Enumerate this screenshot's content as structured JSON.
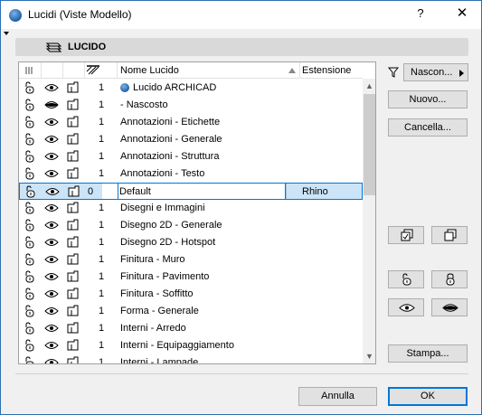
{
  "window": {
    "title": "Lucidi (Viste Modello)",
    "help_label": "?",
    "close_label": "✕"
  },
  "panel": {
    "title": "LUCIDO"
  },
  "list": {
    "columns": {
      "name": "Nome Lucido",
      "extension": "Estensione"
    },
    "rows": [
      {
        "num": "1",
        "name": "Lucido ARCHICAD",
        "ext": "",
        "eye": "open",
        "special_icon": true
      },
      {
        "num": "1",
        "name": "- Nascosto",
        "ext": "",
        "eye": "closed"
      },
      {
        "num": "1",
        "name": "Annotazioni - Etichette",
        "ext": "",
        "eye": "open"
      },
      {
        "num": "1",
        "name": "Annotazioni - Generale",
        "ext": "",
        "eye": "open"
      },
      {
        "num": "1",
        "name": "Annotazioni - Struttura",
        "ext": "",
        "eye": "open"
      },
      {
        "num": "1",
        "name": "Annotazioni - Testo",
        "ext": "",
        "eye": "open"
      },
      {
        "num": "0",
        "name": "Default",
        "ext": "Rhino",
        "eye": "open",
        "selected": true
      },
      {
        "num": "1",
        "name": "Disegni e Immagini",
        "ext": "",
        "eye": "open"
      },
      {
        "num": "1",
        "name": "Disegno 2D - Generale",
        "ext": "",
        "eye": "open"
      },
      {
        "num": "1",
        "name": "Disegno 2D - Hotspot",
        "ext": "",
        "eye": "open"
      },
      {
        "num": "1",
        "name": "Finitura - Muro",
        "ext": "",
        "eye": "open"
      },
      {
        "num": "1",
        "name": "Finitura - Pavimento",
        "ext": "",
        "eye": "open"
      },
      {
        "num": "1",
        "name": "Finitura - Soffitto",
        "ext": "",
        "eye": "open"
      },
      {
        "num": "1",
        "name": "Forma - Generale",
        "ext": "",
        "eye": "open"
      },
      {
        "num": "1",
        "name": "Interni - Arredo",
        "ext": "",
        "eye": "open"
      },
      {
        "num": "1",
        "name": "Interni - Equipaggiamento",
        "ext": "",
        "eye": "open"
      },
      {
        "num": "1",
        "name": "Interni - Lampade",
        "ext": "",
        "eye": "open"
      }
    ]
  },
  "buttons": {
    "nascon": "Nascon...",
    "nuovo": "Nuovo...",
    "cancella": "Cancella...",
    "stampa": "Stampa...",
    "annulla": "Annulla",
    "ok": "OK"
  },
  "colors": {
    "accent": "#0078d7",
    "selection": "#cce4f7",
    "titlebar_border": "#2b6fb3"
  }
}
